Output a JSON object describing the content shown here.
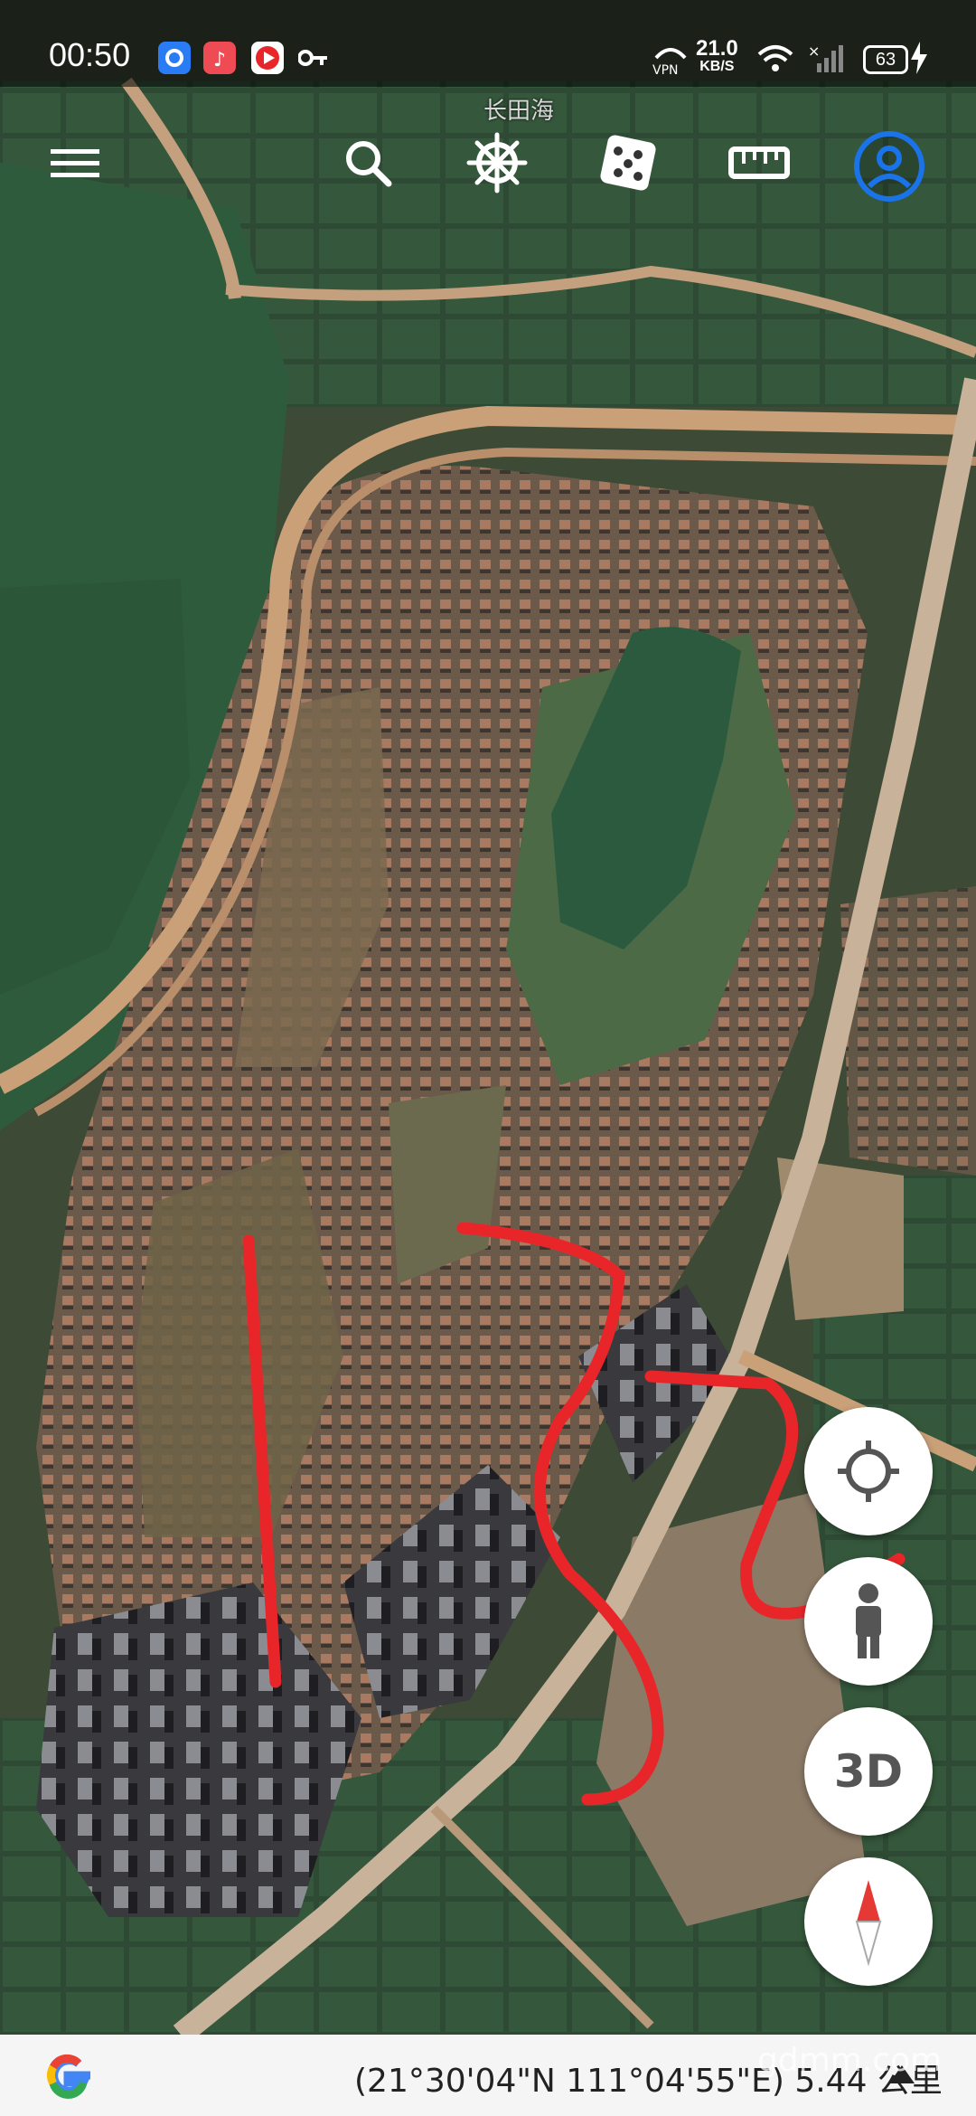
{
  "status_bar": {
    "time": "00:50",
    "vpn_label": "VPN",
    "net_speed": "21.0",
    "net_unit": "KB/S",
    "battery": "63"
  },
  "map": {
    "place_label": "长田海",
    "coordinates": "(21°30'04\"N 111°04'55\"E)",
    "scale": "5.44 公里",
    "watermark": "gdmm.com"
  },
  "toolbar": {
    "menu_icon": "menu-icon",
    "search_icon": "search-icon",
    "voyager_icon": "ship-wheel-icon",
    "random_icon": "dice-icon",
    "measure_icon": "ruler-icon",
    "account_icon": "account-icon"
  },
  "fabs": {
    "locate_icon": "crosshair-icon",
    "streetview_icon": "pegman-icon",
    "three_d_label": "3D",
    "compass_icon": "compass-icon"
  },
  "colors": {
    "accent_blue": "#1a73e8",
    "annotation_red": "#e8262a"
  }
}
